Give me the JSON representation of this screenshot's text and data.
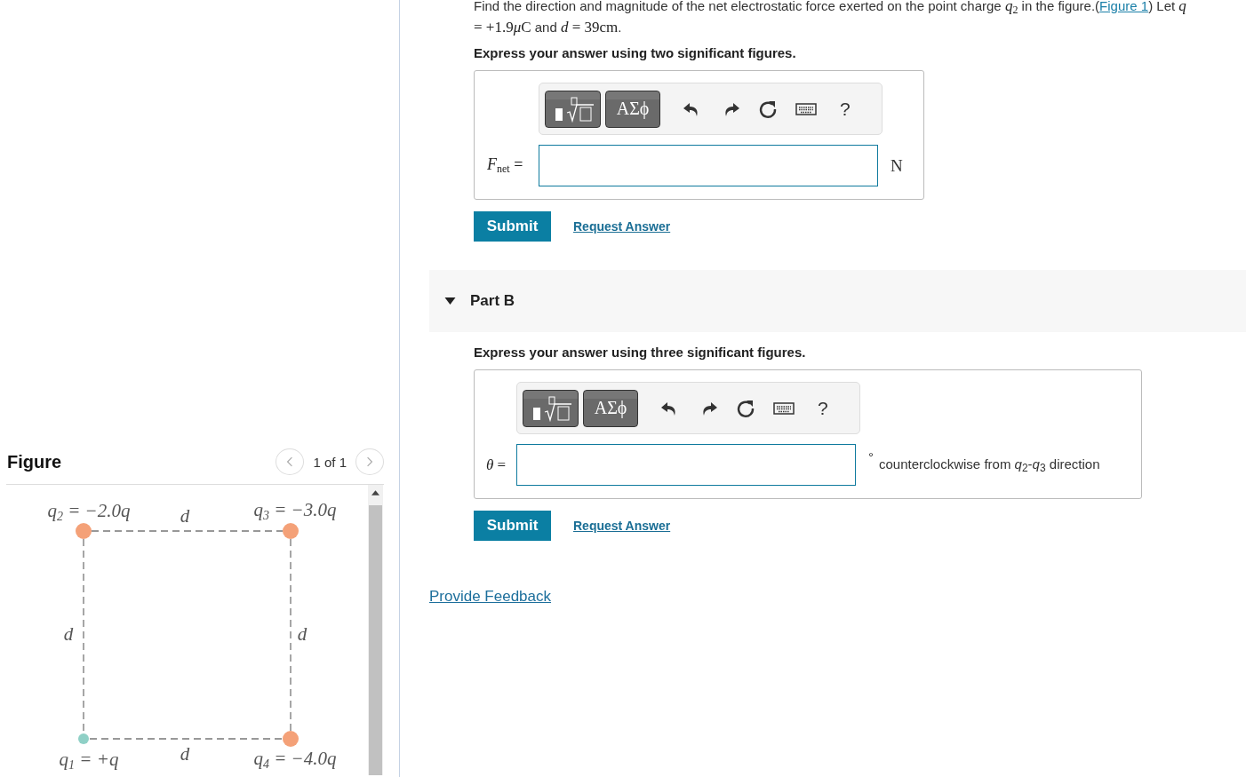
{
  "figure": {
    "heading": "Figure",
    "counter": "1 of 1",
    "charges": [
      {
        "label": "q$_{2}$ = −2.0q",
        "color": "#f4a178"
      },
      {
        "label": "q$_{3}$ = −3.0q",
        "color": "#f4a178"
      },
      {
        "label": "q$_{1}$ = +q",
        "color": "#8fd0c6"
      },
      {
        "label": "q$_{4}$ = −4.0q",
        "color": "#f4a178"
      }
    ],
    "distances": [
      "d",
      "d",
      "d",
      "d"
    ]
  },
  "problem": {
    "statement": [
      {
        "kind": "text",
        "text": "Find the direction and magnitude of the net electrostatic force exerted on the point charge "
      },
      {
        "kind": "var",
        "text": "q$_{2}$"
      },
      {
        "kind": "text",
        "text": " in the figure.("
      },
      {
        "kind": "link",
        "text": "Figure 1"
      },
      {
        "kind": "text",
        "text": ") Let "
      },
      {
        "kind": "var",
        "text": "q"
      },
      {
        "kind": "math",
        "text": " = +1.9"
      },
      {
        "kind": "var",
        "text": "μ"
      },
      {
        "kind": "math",
        "text": "C"
      },
      {
        "kind": "text",
        "text": " and "
      },
      {
        "kind": "var",
        "text": "d"
      },
      {
        "kind": "math",
        "text": " = 39cm"
      },
      {
        "kind": "text",
        "text": "."
      }
    ]
  },
  "parts": [
    {
      "instruction": "Express your answer using two significant figures.",
      "toolbar": {
        "greek": "ΑΣϕ",
        "help": "?"
      },
      "label": "*F*$_{net}$ =",
      "unit": "N",
      "submit": "Submit",
      "request": "Request Answer"
    },
    {
      "title": "Part B",
      "expanded": true,
      "instruction": "Express your answer using three significant figures.",
      "toolbar": {
        "greek": "ΑΣϕ",
        "help": "?"
      },
      "label": "*θ* =",
      "degree": "°",
      "unit": "counterclockwise from *q*$_{2}$-*q*$_{3}$ direction",
      "submit": "Submit",
      "request": "Request Answer"
    }
  ],
  "feedback_link": "Provide Feedback"
}
